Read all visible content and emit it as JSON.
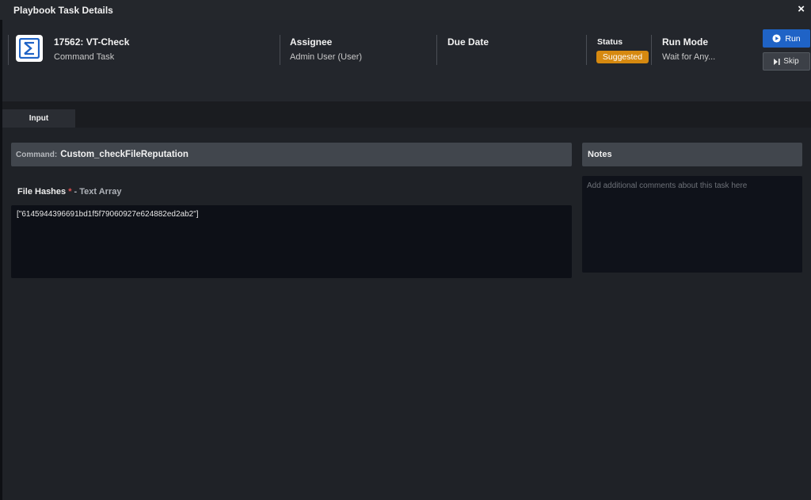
{
  "window": {
    "title": "Playbook Task Details",
    "close_icon": "×"
  },
  "task": {
    "icon": "command-task-icon",
    "id_title": "17562: VT-Check",
    "type": "Command Task"
  },
  "assignee": {
    "label": "Assignee",
    "value": "Admin User (User)"
  },
  "due_date": {
    "label": "Due Date",
    "value": ""
  },
  "status": {
    "label": "Status",
    "value": "Suggested",
    "color": "#d68910"
  },
  "run_mode": {
    "label": "Run Mode",
    "value": "Wait for Any..."
  },
  "actions": {
    "run_label": "Run",
    "skip_label": "Skip"
  },
  "tabs": [
    {
      "label": "Input",
      "active": true
    }
  ],
  "command": {
    "label": "Command:",
    "value": "Custom_checkFileReputation"
  },
  "inputs": {
    "file_hashes": {
      "label": "File Hashes",
      "required_mark": "*",
      "type": "- Text Array",
      "value": "[\"6145944396691bd1f5f79060927e624882ed2ab2\"]"
    }
  },
  "notes": {
    "label": "Notes",
    "placeholder": "Add additional comments about this task here"
  },
  "colors": {
    "accent": "#1f63c6",
    "background": "#1f2227",
    "panel": "#41464d"
  }
}
